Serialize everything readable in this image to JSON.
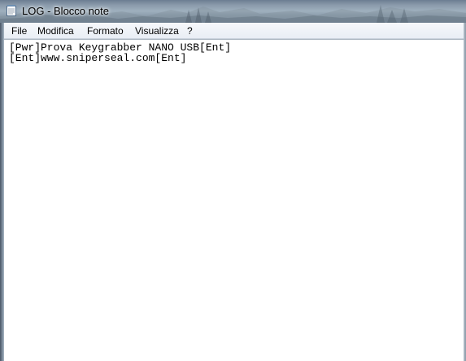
{
  "window": {
    "title": "LOG - Blocco note",
    "icon": "notepad-icon"
  },
  "menubar": {
    "items": [
      {
        "label": "File"
      },
      {
        "label": "Modifica"
      },
      {
        "label": "Formato"
      },
      {
        "label": "Visualizza"
      },
      {
        "label": "?"
      }
    ]
  },
  "editor": {
    "lines": [
      "[Pwr]Prova Keygrabber NANO USB[Ent]",
      "[Ent]www.sniperseal.com[Ent]"
    ]
  },
  "colors": {
    "titlebar": "#8a9aab",
    "menubar": "#eef2f7",
    "editor_background": "#ffffff",
    "text": "#000000"
  }
}
